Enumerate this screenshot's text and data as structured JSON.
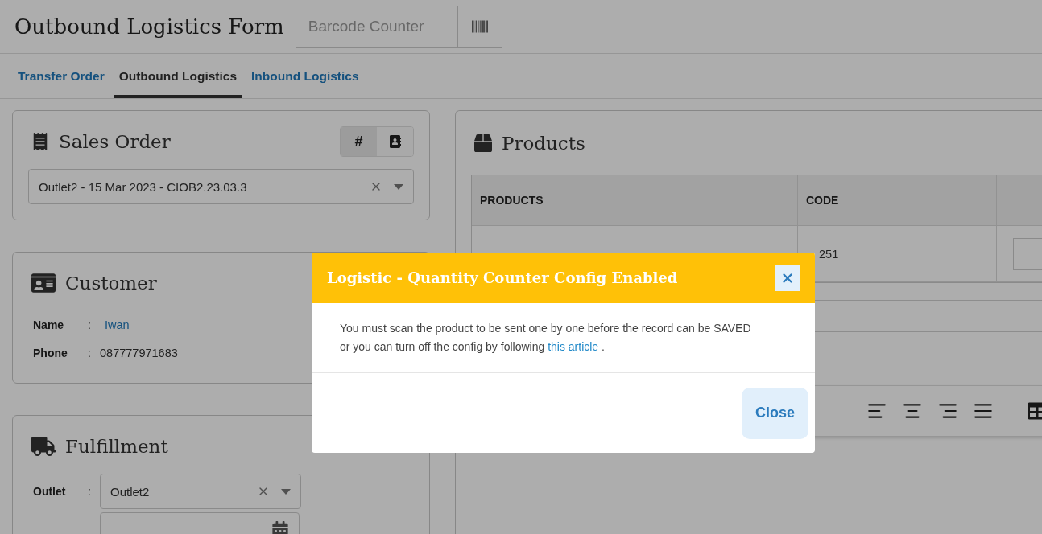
{
  "header": {
    "title": "Outbound Logistics Form",
    "barcode_field": {
      "placeholder": "Barcode Counter"
    }
  },
  "tabs": [
    {
      "label": "Transfer Order",
      "selected": false
    },
    {
      "label": "Outbound Logistics",
      "selected": true
    },
    {
      "label": "Inbound Logistics",
      "selected": false
    }
  ],
  "sales_order": {
    "title": "Sales Order",
    "modes": [
      {
        "kind": "text",
        "label": "#",
        "selected": true
      },
      {
        "kind": "contact",
        "selected": false
      }
    ],
    "select": {
      "value": "Outlet2 - 15 Mar 2023 - CIOB2.23.03.3"
    }
  },
  "customer": {
    "title": "Customer",
    "fields": [
      {
        "kind": "link",
        "label": "Name",
        "separator": ":",
        "value": "Iwan"
      },
      {
        "kind": "plain",
        "label": "Phone",
        "separator": ":",
        "value": "087777971683"
      }
    ]
  },
  "fulfillment": {
    "title": "Fulfillment",
    "fields": [
      {
        "kind": "select",
        "label": "Outlet",
        "separator": ":",
        "value": "Outlet2"
      },
      {
        "kind": "date"
      }
    ]
  },
  "products": {
    "title": "Products",
    "columns": [
      "PRODUCTS",
      "CODE"
    ],
    "rows": [
      {
        "code": "251"
      }
    ]
  },
  "dialog": {
    "title": "Logistic - Quantity Counter Config Enabled",
    "line1": "You must scan the product to be sent one by one before the record can be SAVED",
    "line2": "or you can turn off the config by following",
    "link": "this article",
    "end": ".",
    "close_label": "Close"
  }
}
